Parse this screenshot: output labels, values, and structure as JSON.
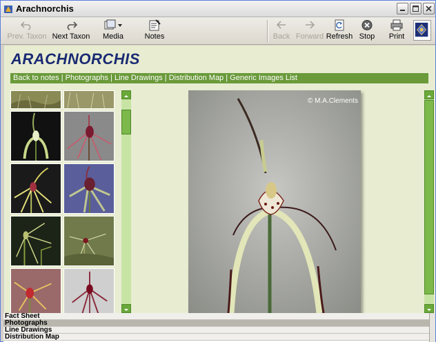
{
  "window": {
    "title": "Arachnorchis"
  },
  "toolbar": {
    "prev_taxon": "Prev. Taxon",
    "next_taxon": "Next Taxon",
    "media": "Media",
    "notes": "Notes",
    "back": "Back",
    "forward": "Forward",
    "refresh": "Refresh",
    "stop": "Stop",
    "print": "Print"
  },
  "page": {
    "title": "ARACHNORCHIS",
    "nav": [
      "Back to notes",
      "Photographs",
      "Line Drawings",
      "Distribution Map",
      "Generic Images List"
    ],
    "photo_credit": "© M.A.Clements"
  },
  "sections": [
    "Fact Sheet",
    "Photographs",
    "Line Drawings",
    "Distribution Map"
  ],
  "selected_section": "Photographs",
  "colors": {
    "accent_green": "#6a9a3a",
    "title_navy": "#1a2a73",
    "panel_bg": "#e8edd2"
  }
}
